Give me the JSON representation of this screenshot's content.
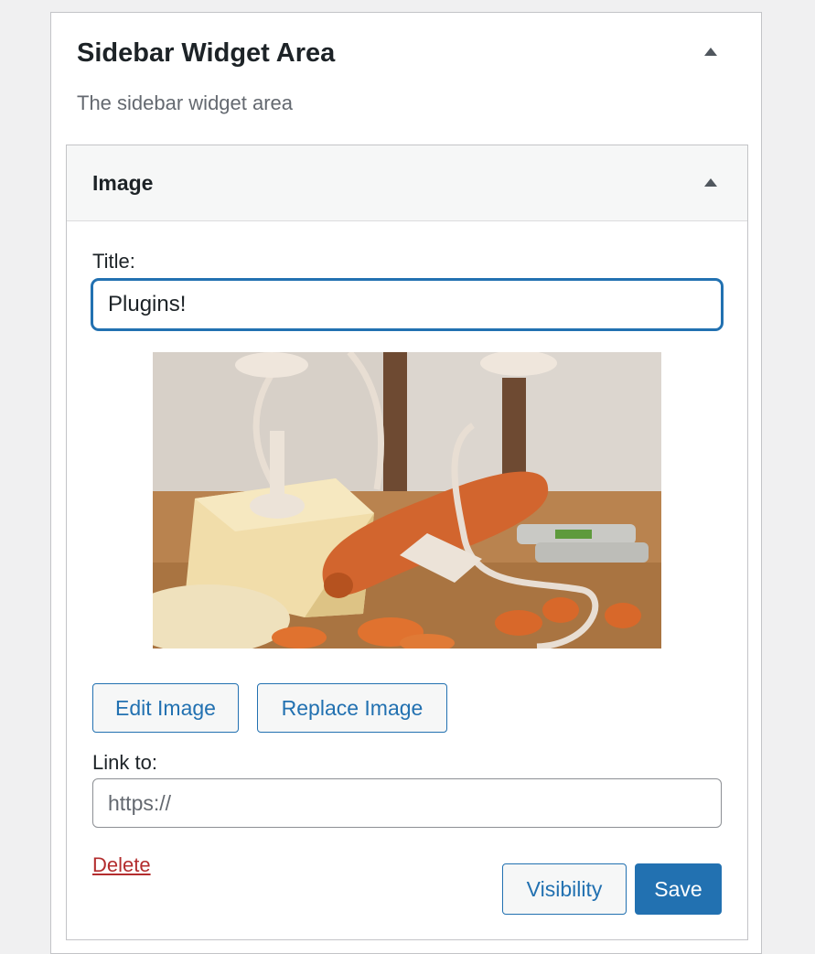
{
  "area": {
    "title": "Sidebar Widget Area",
    "description": "The sidebar widget area"
  },
  "widget": {
    "name": "Image",
    "title_label": "Title:",
    "title_value": "Plugins!",
    "edit_image_label": "Edit Image",
    "replace_image_label": "Replace Image",
    "link_label": "Link to:",
    "link_placeholder": "https://",
    "delete_label": "Delete",
    "visibility_label": "Visibility",
    "save_label": "Save",
    "image_alt": "Photo of a carrot, cheese block, and batteries plugged with white cords"
  },
  "colors": {
    "accent": "#2271b1",
    "danger": "#b32d2e",
    "background": "#f0f0f1"
  },
  "icons": {
    "toggle": "triangle-up-icon"
  }
}
